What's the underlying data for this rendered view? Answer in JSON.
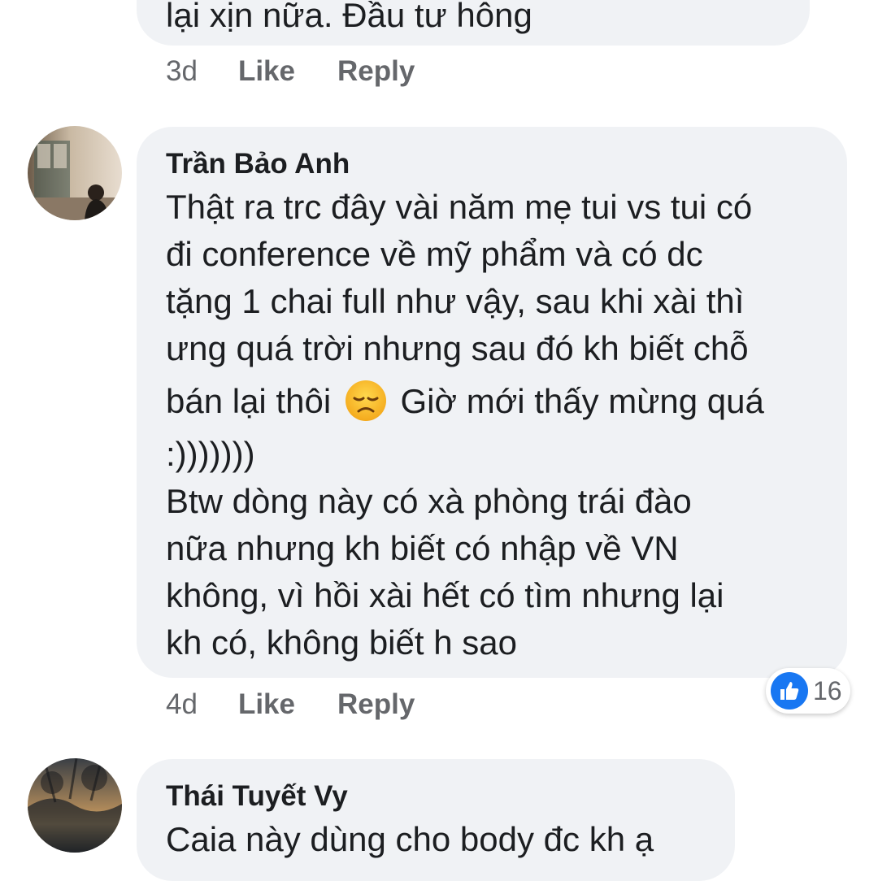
{
  "comments": [
    {
      "author": "",
      "text_lines": [
        "lại xịn nữa. Đầu tư hông"
      ],
      "time": "3d",
      "like_label": "Like",
      "reply_label": "Reply"
    },
    {
      "author": "Trần Bảo Anh",
      "text_lines": [
        "Thật ra trc đây vài năm mẹ tui vs tui có",
        "đi conference về mỹ phẩm và có dc",
        "tặng 1 chai full như vậy, sau khi xài thì",
        "ưng quá trời nhưng sau đó kh biết chỗ",
        "bán lại thôi",
        " Giờ mới thấy mừng quá",
        ":)))))))",
        "Btw dòng này có xà phòng trái đào",
        "nữa nhưng kh biết có nhập về VN",
        "không, vì hồi xài hết có tìm nhưng lại",
        "kh có, không biết h sao"
      ],
      "emoji": "disappointed-face-emoji",
      "time": "4d",
      "like_label": "Like",
      "reply_label": "Reply",
      "reaction_count": "16",
      "reaction_icon": "thumbs-up-icon"
    },
    {
      "author": "Thái Tuyết Vy",
      "text_lines": [
        "Caia này dùng cho body đc kh ạ"
      ]
    }
  ],
  "colors": {
    "bubble": "#f0f2f5",
    "meta_text": "#65676b",
    "like_blue": "#1877f2",
    "text": "#1c1e21"
  }
}
